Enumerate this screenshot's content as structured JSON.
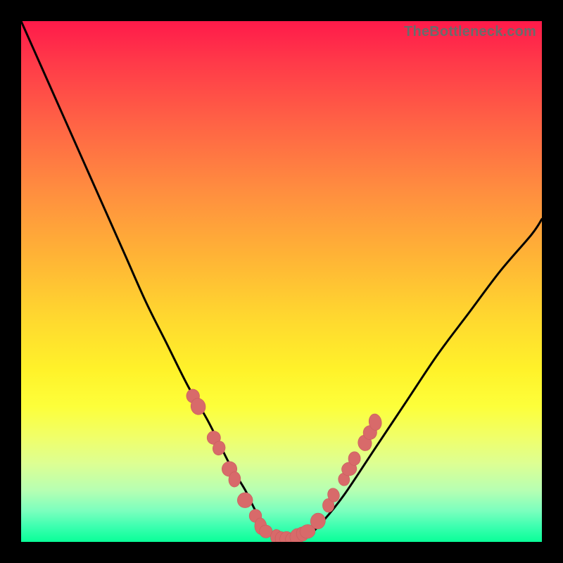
{
  "attribution": "TheBottleneck.com",
  "colors": {
    "background": "#000000",
    "gradient_top": "#ff1a4a",
    "gradient_bottom": "#09ff98",
    "curve": "#000000",
    "marker": "#d86a6a"
  },
  "chart_data": {
    "type": "line",
    "title": "",
    "xlabel": "",
    "ylabel": "",
    "xlim": [
      0,
      100
    ],
    "ylim": [
      0,
      100
    ],
    "grid": false,
    "series": [
      {
        "name": "bottleneck-curve",
        "x": [
          0,
          4,
          8,
          12,
          16,
          20,
          24,
          28,
          32,
          36,
          40,
          43,
          45,
          47,
          49,
          51,
          53,
          55,
          58,
          62,
          68,
          74,
          80,
          86,
          92,
          98,
          100
        ],
        "y": [
          100,
          91,
          82,
          73,
          64,
          55,
          46,
          38,
          30,
          23,
          15,
          10,
          6,
          3,
          1,
          0,
          0,
          1,
          4,
          9,
          18,
          27,
          36,
          44,
          52,
          59,
          62
        ]
      }
    ],
    "markers": {
      "name": "highlight-points",
      "points": [
        {
          "x": 33,
          "y": 28
        },
        {
          "x": 34,
          "y": 26
        },
        {
          "x": 37,
          "y": 20
        },
        {
          "x": 38,
          "y": 18
        },
        {
          "x": 40,
          "y": 14
        },
        {
          "x": 41,
          "y": 12
        },
        {
          "x": 43,
          "y": 8
        },
        {
          "x": 45,
          "y": 5
        },
        {
          "x": 46,
          "y": 3
        },
        {
          "x": 47,
          "y": 2
        },
        {
          "x": 49,
          "y": 1
        },
        {
          "x": 50,
          "y": 0.5
        },
        {
          "x": 51,
          "y": 0.5
        },
        {
          "x": 52,
          "y": 0.5
        },
        {
          "x": 53,
          "y": 1
        },
        {
          "x": 54,
          "y": 1.5
        },
        {
          "x": 55,
          "y": 2
        },
        {
          "x": 57,
          "y": 4
        },
        {
          "x": 59,
          "y": 7
        },
        {
          "x": 60,
          "y": 9
        },
        {
          "x": 62,
          "y": 12
        },
        {
          "x": 63,
          "y": 14
        },
        {
          "x": 64,
          "y": 16
        },
        {
          "x": 66,
          "y": 19
        },
        {
          "x": 67,
          "y": 21
        },
        {
          "x": 68,
          "y": 23
        }
      ]
    }
  }
}
